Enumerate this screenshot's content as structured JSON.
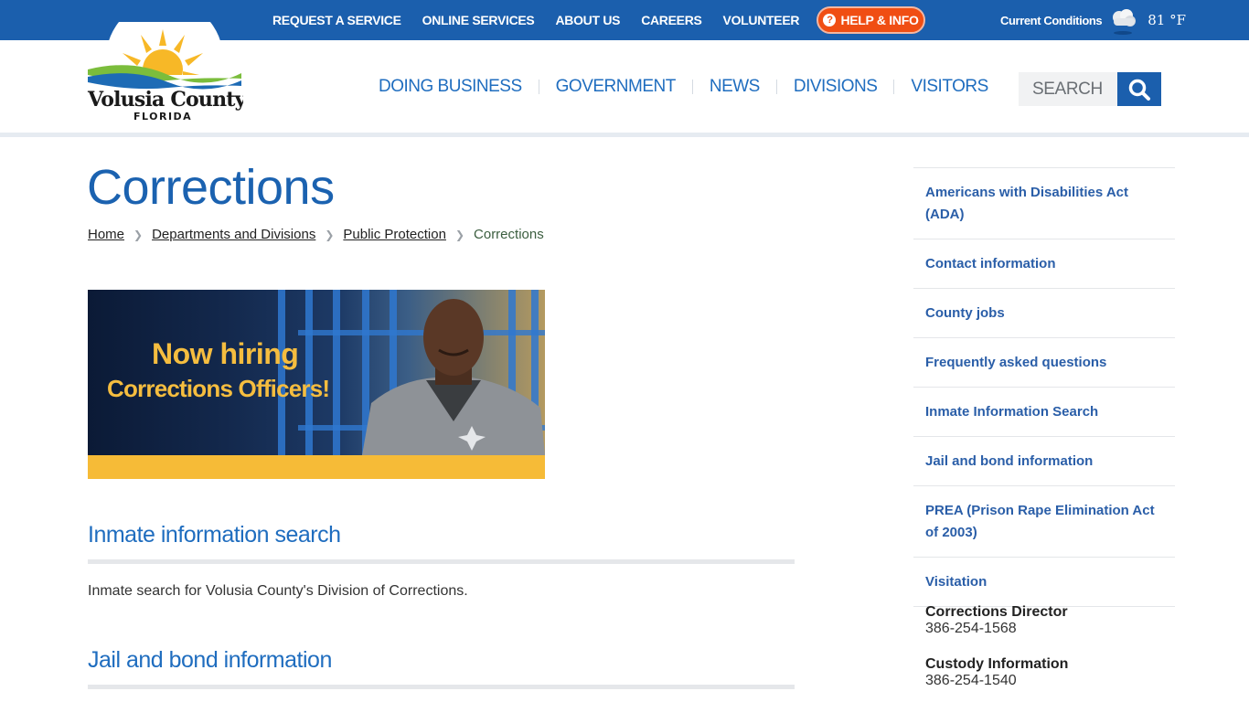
{
  "topbar": {
    "nav": [
      "REQUEST A SERVICE",
      "ONLINE SERVICES",
      "ABOUT US",
      "CAREERS",
      "VOLUNTEER"
    ],
    "help_label": "HELP & INFO",
    "help_icon": "question-circle-icon",
    "conditions_label": "Current Conditions",
    "weather_icon": "cloudy-icon",
    "temperature": "81 °F"
  },
  "header": {
    "logo": {
      "name": "Volusia County",
      "sub": "FLORIDA"
    },
    "nav": [
      "DOING BUSINESS",
      "GOVERNMENT",
      "NEWS",
      "DIVISIONS",
      "VISITORS"
    ],
    "search_placeholder": "SEARCH",
    "search_icon": "magnifier-icon"
  },
  "main": {
    "title": "Corrections",
    "breadcrumb": [
      "Home",
      "Departments and Divisions",
      "Public Protection",
      "Corrections"
    ],
    "banner": {
      "line1": "Now hiring",
      "line2": "Corrections Officers!",
      "colors": {
        "text": "#f5bd3f",
        "bar": "#f6bb37"
      }
    },
    "sections": [
      {
        "heading": "Inmate information search",
        "text": "Inmate search for Volusia County's Division of Corrections."
      },
      {
        "heading": "Jail and bond information",
        "text": ""
      }
    ]
  },
  "sidebar": {
    "links": [
      "Americans with Disabilities Act (ADA)",
      "Contact information",
      "County jobs",
      "Frequently asked questions",
      "Inmate Information Search",
      "Jail and bond information",
      "PREA (Prison Rape Elimination Act of 2003)",
      "Visitation"
    ],
    "contacts": [
      {
        "title": "Corrections Director",
        "phone": "386-254-1568"
      },
      {
        "title": "Custody Information",
        "phone": "386-254-1540"
      }
    ]
  },
  "colors": {
    "brand_blue": "#1b5fad",
    "link_blue": "#1f6dbf",
    "help_orange": "#f04e13"
  }
}
